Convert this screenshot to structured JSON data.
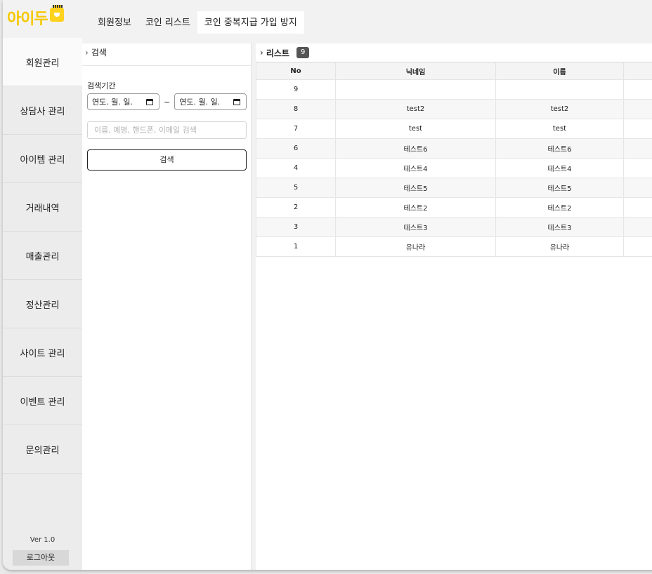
{
  "app": {
    "logo_text": "아이두"
  },
  "tabs": [
    {
      "label": "회원정보",
      "active": false
    },
    {
      "label": "코인 리스트",
      "active": false
    },
    {
      "label": "코인 중복지급 가입 방지",
      "active": true
    }
  ],
  "sidebar": {
    "items": [
      {
        "label": "회원관리",
        "active": true
      },
      {
        "label": "상담사 관리",
        "active": false
      },
      {
        "label": "아이템 관리",
        "active": false
      },
      {
        "label": "거래내역",
        "active": false
      },
      {
        "label": "매출관리",
        "active": false
      },
      {
        "label": "정산관리",
        "active": false
      },
      {
        "label": "사이트 관리",
        "active": false
      },
      {
        "label": "이벤트 관리",
        "active": false
      },
      {
        "label": "문의관리",
        "active": false
      }
    ],
    "version": "Ver 1.0",
    "logout_label": "로그아웃"
  },
  "search": {
    "header": "검색",
    "period_label": "검색기간",
    "date_from": "연도. 월. 일.",
    "date_to": "연도. 월. 일.",
    "range_sep": "~",
    "text_placeholder": "이름, 예명, 핸드폰, 이메일 검색",
    "button_label": "검색"
  },
  "list": {
    "header": "리스트",
    "count": "9",
    "columns": [
      "No",
      "닉네임",
      "이름",
      ""
    ],
    "rows": [
      [
        "9",
        "",
        "",
        ""
      ],
      [
        "8",
        "test2",
        "test2",
        ""
      ],
      [
        "7",
        "test",
        "test",
        ""
      ],
      [
        "6",
        "테스트6",
        "테스트6",
        ""
      ],
      [
        "4",
        "테스트4",
        "테스트4",
        ""
      ],
      [
        "5",
        "테스트5",
        "테스트5",
        ""
      ],
      [
        "2",
        "테스트2",
        "테스트2",
        ""
      ],
      [
        "3",
        "테스트3",
        "테스트3",
        ""
      ],
      [
        "1",
        "유나라",
        "유나라",
        ""
      ]
    ]
  },
  "colors": {
    "brand_yellow": "#f6c800",
    "badge_bg": "#555555"
  }
}
